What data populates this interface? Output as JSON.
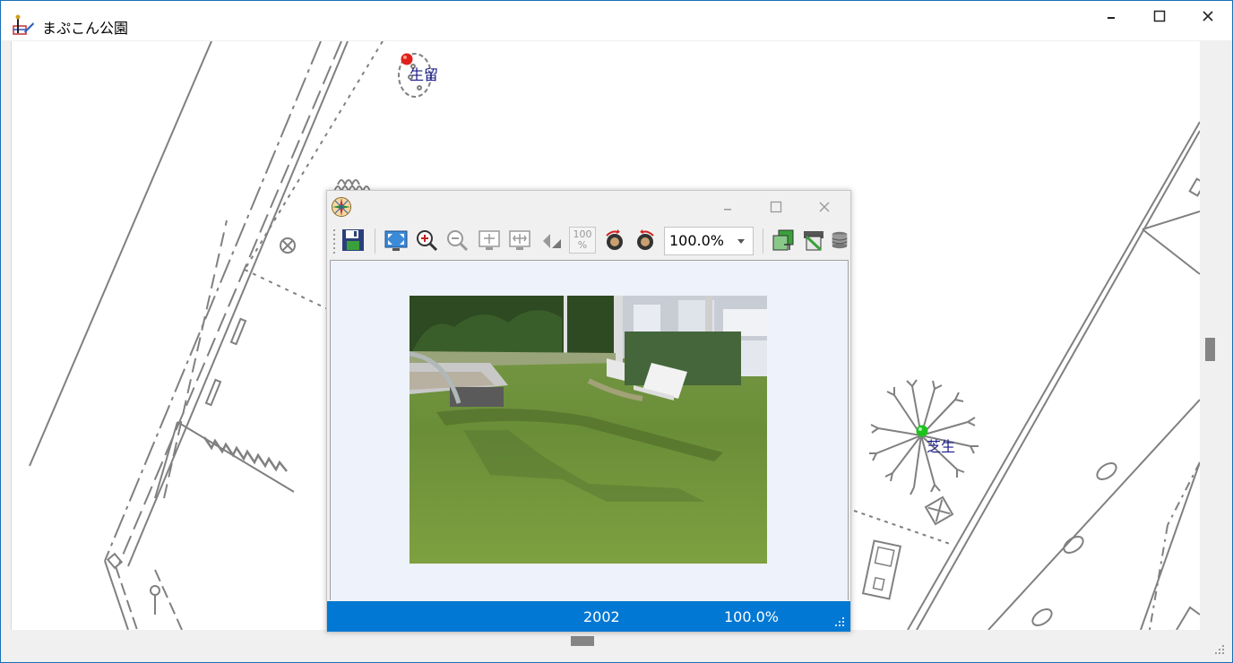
{
  "window": {
    "title": "まぷこん公園"
  },
  "map": {
    "markers": [
      {
        "label": "生留",
        "color": "#e0201a"
      },
      {
        "label": "芝生",
        "color": "#1ec21e"
      }
    ]
  },
  "viewer": {
    "toolbar": {
      "zoom_value": "100.0%",
      "reset_label": "100 %"
    },
    "status": {
      "year": "2002",
      "zoom": "100.0%"
    },
    "status_color": "#0078d4"
  },
  "icons": {
    "app": "survey-app-icon",
    "viewer": "compass-rose-icon",
    "minimize": "minimize-icon",
    "maximize": "maximize-icon",
    "close": "close-icon"
  }
}
